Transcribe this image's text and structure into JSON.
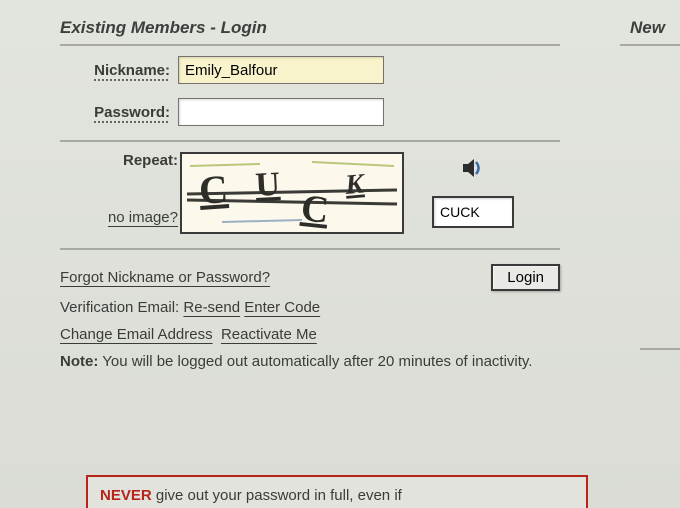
{
  "heading": "Existing Members - Login",
  "new_heading": "New",
  "nickname": {
    "label": "Nickname:",
    "value": "Emily_Balfour"
  },
  "password": {
    "label": "Password:",
    "value": ""
  },
  "captcha": {
    "label": "Repeat:",
    "no_image": "no image?",
    "value": "CUCK"
  },
  "forgot": "Forgot Nickname or Password?",
  "login_button": "Login",
  "verification": {
    "prefix": "Verification Email:",
    "resend": "Re-send",
    "enter": "Enter Code"
  },
  "change_email": "Change Email Address",
  "reactivate": "Reactivate Me",
  "note": {
    "bold": "Note:",
    "text": " You will be logged out automatically after 20 minutes of inactivity."
  },
  "warning": {
    "never": "NEVER",
    "text": " give out your password in full, even if"
  }
}
